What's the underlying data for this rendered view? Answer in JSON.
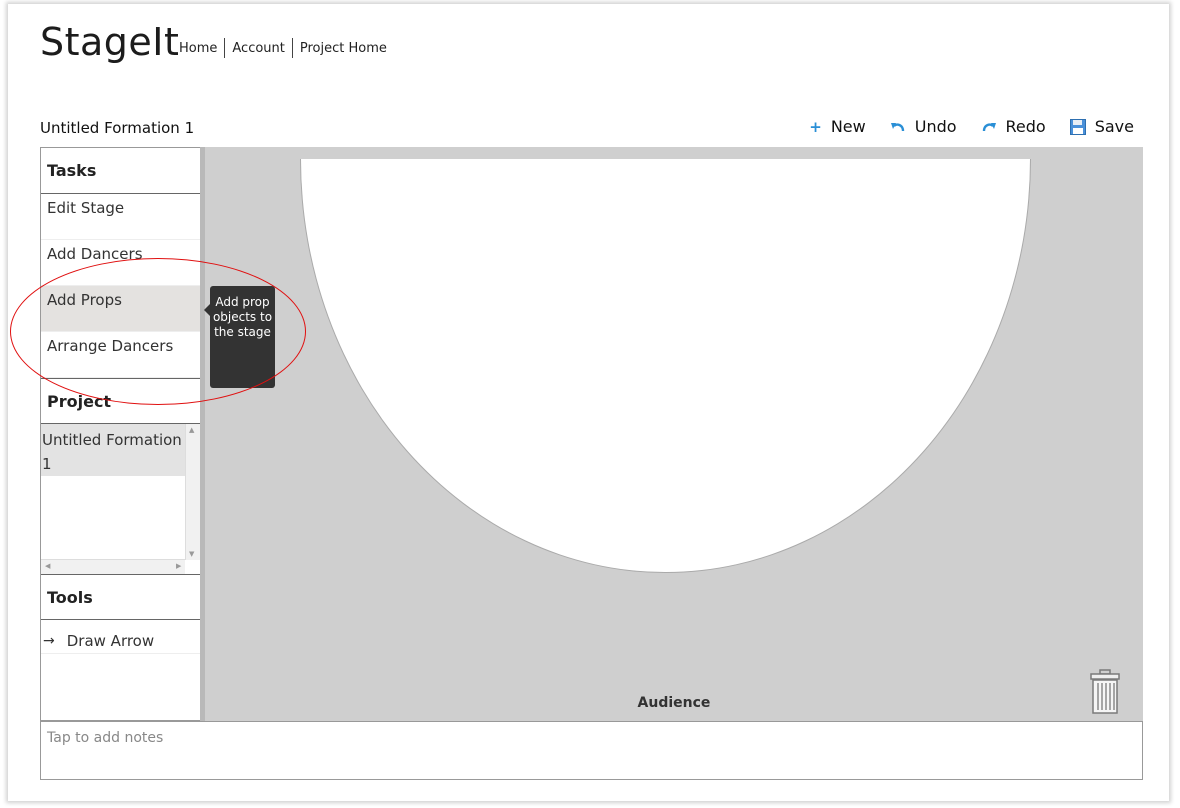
{
  "app": {
    "logo": "StageIt"
  },
  "nav": [
    "Home",
    "Account",
    "Project Home"
  ],
  "formation_title": "Untitled Formation 1",
  "toolbar": {
    "new_label": "New",
    "undo_label": "Undo",
    "redo_label": "Redo",
    "save_label": "Save",
    "accent_color": "#2a8fd6"
  },
  "sidebar": {
    "tasks_heading": "Tasks",
    "tasks": [
      "Edit Stage",
      "Add Dancers",
      "Add Props",
      "Arrange Dancers"
    ],
    "active_task": "Add Props",
    "project_heading": "Project",
    "project_items": [
      "Untitled Formation 1"
    ],
    "tools_heading": "Tools",
    "tools": [
      "Draw Arrow"
    ]
  },
  "tooltip": {
    "text": "Add prop objects to the stage"
  },
  "stage": {
    "audience_label": "Audience"
  },
  "notes": {
    "placeholder": "Tap to add notes"
  },
  "annotation": {
    "color": "#e01010"
  }
}
